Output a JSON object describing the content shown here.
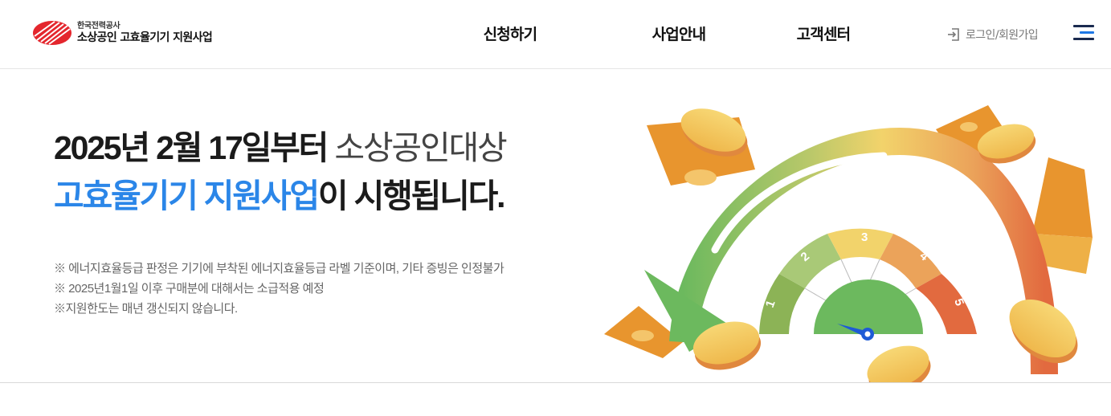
{
  "logo": {
    "org": "한국전력공사",
    "service": "소상공인 고효율기기 지원사업"
  },
  "nav": {
    "items": [
      "신청하기",
      "사업안내",
      "고객센터"
    ]
  },
  "header": {
    "login_label": "로그인/회원가입",
    "login_icon": "login-icon",
    "menu_icon": "hamburger-menu-icon"
  },
  "hero": {
    "headline_line1_bold": "2025년 2월 17일부터",
    "headline_line1_light": " 소상공인대상",
    "headline_line2_blue": "고효율기기 지원사업",
    "headline_line2_bold": "이 시행됩니다.",
    "notes": [
      "※ 에너지효율등급 판정은 기기에 부착된 에너지효율등급 라벨 기준이며, 기타 증빙은 인정불가",
      "※ 2025년1월1일 이후 구매분에 대해서는 소급적용 예정",
      "※지원한도는 매년 갱신되지 않습니다."
    ],
    "gauge_labels": [
      "1",
      "2",
      "3",
      "4",
      "5"
    ]
  },
  "colors": {
    "accent_blue": "#2b86e8",
    "logo_red": "#e4262d",
    "navy": "#1a2a4f",
    "gauge_green": "#6cb95e",
    "gauge_yellow": "#f2d36b",
    "gauge_orange": "#eba35a",
    "gauge_red": "#e26a3f"
  }
}
